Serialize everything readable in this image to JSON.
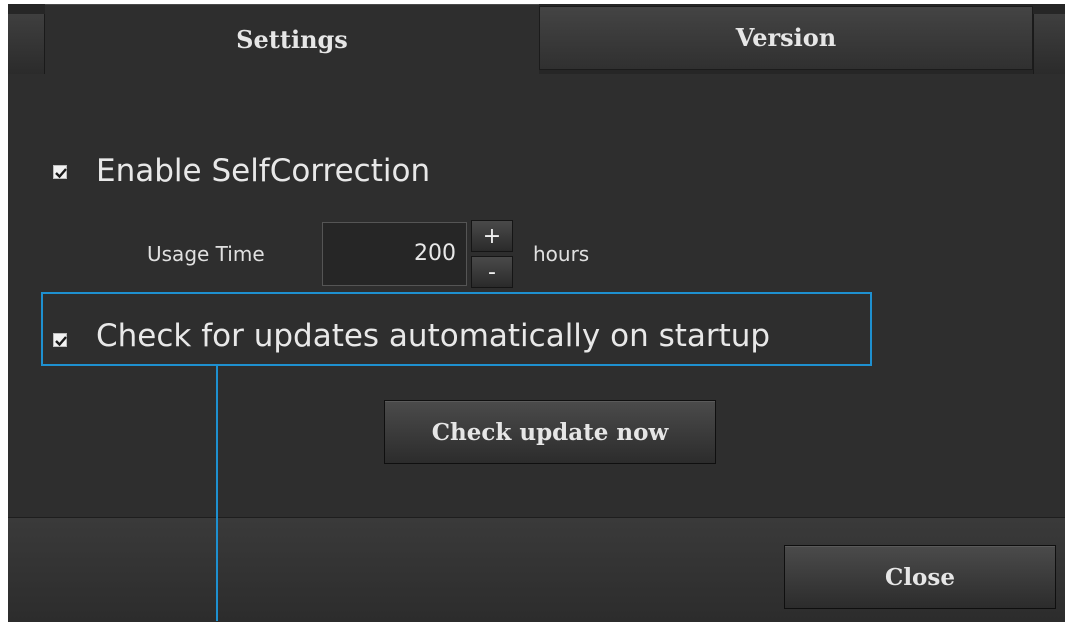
{
  "tabs": [
    {
      "label": "Settings",
      "active": true
    },
    {
      "label": "Version",
      "active": false
    }
  ],
  "settings": {
    "self_correction": {
      "label": "Enable SelfCorrection",
      "checked": true
    },
    "usage_time": {
      "label": "Usage Time",
      "value": "200",
      "unit": "hours",
      "increment": "+",
      "decrement": "-"
    },
    "auto_update": {
      "label": "Check for updates automatically on startup",
      "checked": true
    },
    "check_update_button": "Check update now"
  },
  "footer": {
    "close_button": "Close"
  },
  "colors": {
    "background": "#2e2e2e",
    "highlight": "#1e90d0",
    "text": "#e8e8e8"
  }
}
